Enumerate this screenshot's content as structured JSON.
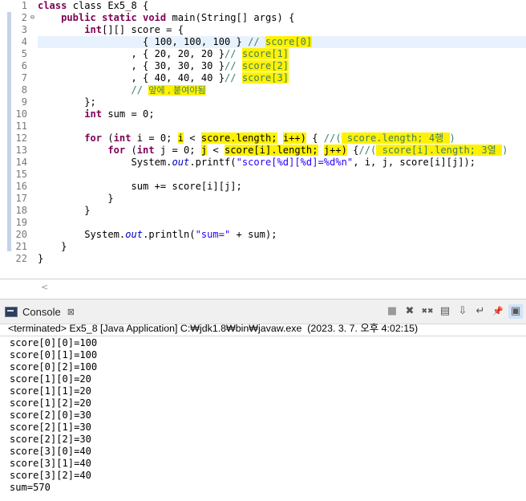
{
  "editor": {
    "line_numbers": [
      "1",
      "2",
      "3",
      "4",
      "5",
      "6",
      "7",
      "8",
      "9",
      "10",
      "11",
      "12",
      "13",
      "14",
      "15",
      "16",
      "17",
      "18",
      "19",
      "20",
      "21",
      "22"
    ],
    "fold_marker": "⊖",
    "lines": {
      "l1": "class Ex5_8 {",
      "l2a": "    ",
      "l2kw": "public static void",
      "l2b": " main(String[] args) {",
      "l3a": "        ",
      "l3kw": "int",
      "l3b": "[][] score = {",
      "l4a": "                  { 100, 100, 100 } ",
      "l4c": "// ",
      "l4h": "score[0]",
      "l5a": "                , { 20, 20, 20 }",
      "l5c": "// ",
      "l5h": "score[1]",
      "l6a": "                , { 30, 30, 30 }",
      "l6c": "// ",
      "l6h": "score[2]",
      "l7a": "                , { 40, 40, 40 }",
      "l7c": "// ",
      "l7h": "score[3]",
      "l8a": "                ",
      "l8c": "// ",
      "l8h": "앞에 , 붙여야됨",
      "l9": "        };",
      "l10a": "        ",
      "l10kw": "int",
      "l10b": " sum = 0;",
      "l12a": "        ",
      "l12kw1": "for",
      "l12b": " (",
      "l12kw2": "int",
      "l12c": " i = 0; ",
      "l12h1": "i",
      "l12d": " < ",
      "l12h2": "score.length;",
      "l12e": " ",
      "l12h3": "i++)",
      "l12f": " { ",
      "l12g": "//(",
      "l12h4": " score.length; 4행 ",
      "l12i": ")",
      "l13a": "            ",
      "l13kw1": "for",
      "l13b": " (",
      "l13kw2": "int",
      "l13c": " j = 0; ",
      "l13h1": "j",
      "l13d": " < ",
      "l13h2": "score[i].length;",
      "l13e": " ",
      "l13h3": "j++)",
      "l13f": " {",
      "l13g": "//(",
      "l13h4": " score[i].length; 3열 ",
      "l13i": ")",
      "l14a": "                System.",
      "l14f": "out",
      "l14b": ".printf(",
      "l14s": "\"score[%d][%d]=%d%n\"",
      "l14c": ", i, j, score[i][j]);",
      "l16": "                sum += score[i][j];",
      "l17": "            }",
      "l18": "        }",
      "l20a": "        System.",
      "l20f": "out",
      "l20b": ".println(",
      "l20s": "\"sum=\"",
      "l20c": " + sum);",
      "l21": "    }",
      "l22": "}"
    },
    "scroll_left_arrow": "<"
  },
  "console": {
    "tab_label": "Console",
    "close_glyph": "⊠",
    "toolbar_icons": [
      "stop-icon",
      "remove-launch-icon",
      "remove-all-icon",
      "clear-console-icon",
      "scroll-lock-icon",
      "word-wrap-icon",
      "pin-console-icon",
      "display-selected-console-icon"
    ],
    "toolbar_glyphs": [
      "■",
      "✖",
      "✖✖",
      "▤",
      "⇩",
      "↵",
      "📌",
      "▣"
    ],
    "status": "<terminated> Ex5_8 [Java Application] C:₩jdk1.8₩bin₩javaw.exe  (2023. 3. 7. 오후 4:02:15)",
    "output": [
      "score[0][0]=100",
      "score[0][1]=100",
      "score[0][2]=100",
      "score[1][0]=20",
      "score[1][1]=20",
      "score[1][2]=20",
      "score[2][0]=30",
      "score[2][1]=30",
      "score[2][2]=30",
      "score[3][0]=40",
      "score[3][1]=40",
      "score[3][2]=40",
      "sum=570"
    ]
  }
}
